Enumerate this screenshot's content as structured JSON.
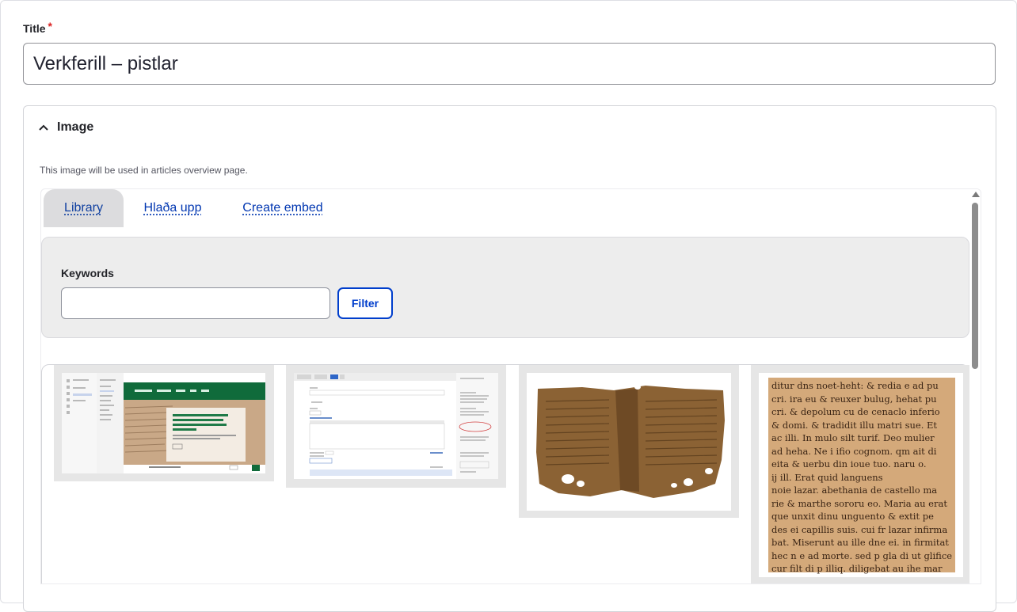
{
  "title_field": {
    "label": "Title",
    "required_mark": "*",
    "value": "Verkferill – pistlar"
  },
  "image_section": {
    "summary": "Image",
    "description": "This image will be used in articles overview page.",
    "tabs": [
      {
        "label": "Library",
        "active": true
      },
      {
        "label": "Hlaða upp",
        "active": false
      },
      {
        "label": "Create embed",
        "active": false
      }
    ],
    "filter": {
      "keywords_label": "Keywords",
      "keywords_value": "",
      "button_label": "Filter"
    },
    "media_items": [
      {
        "name": "screenshot-website-hero"
      },
      {
        "name": "screenshot-cms-editor"
      },
      {
        "name": "manuscript-fragment-dark"
      },
      {
        "name": "manuscript-page-latin"
      }
    ],
    "thumb_text": {
      "website_hero_heading": "Hlinna kängsins hurfkegti – óréttar ar tölvnalum og greipakana handritana frá 15. öld",
      "website_caption": "Nýjustu færslugar",
      "manuscript_lines": [
        "ditur dns noet-heht: & redia e ad pu",
        "cri. ira eu & reuxer bulug, hehat pu",
        "cri. & depolum cu de cenaclo inferio",
        "& domi. & tradidit illu matri sue. Et",
        "ac illi. In mulo silt turif. Deo mulier",
        "ad heha. Ne i ifio cognom. qm ait di",
        "eita & uerbu din ioue tuo. naru o.",
        "ij ill. Erat quid languens",
        "noie lazar. abethania de castello ma",
        "rie & marthe sororu eo. Maria au erat",
        "que unxit dinu unguento & extit pe",
        "des ei capillis suis. cui fr lazar infirma",
        "bat. Miserunt au ille dne ei. in firmitat",
        "hec n e ad morte. sed p gla di ut glifice",
        "cur filt di p illiq. diligebat au ihe mar"
      ]
    }
  },
  "colors": {
    "link": "#0036b1",
    "button_border": "#003ecc",
    "required": "#dc2323",
    "tab_active_bg": "#dcdcde",
    "filter_bg": "#ededed",
    "site_green": "#106b3b"
  }
}
